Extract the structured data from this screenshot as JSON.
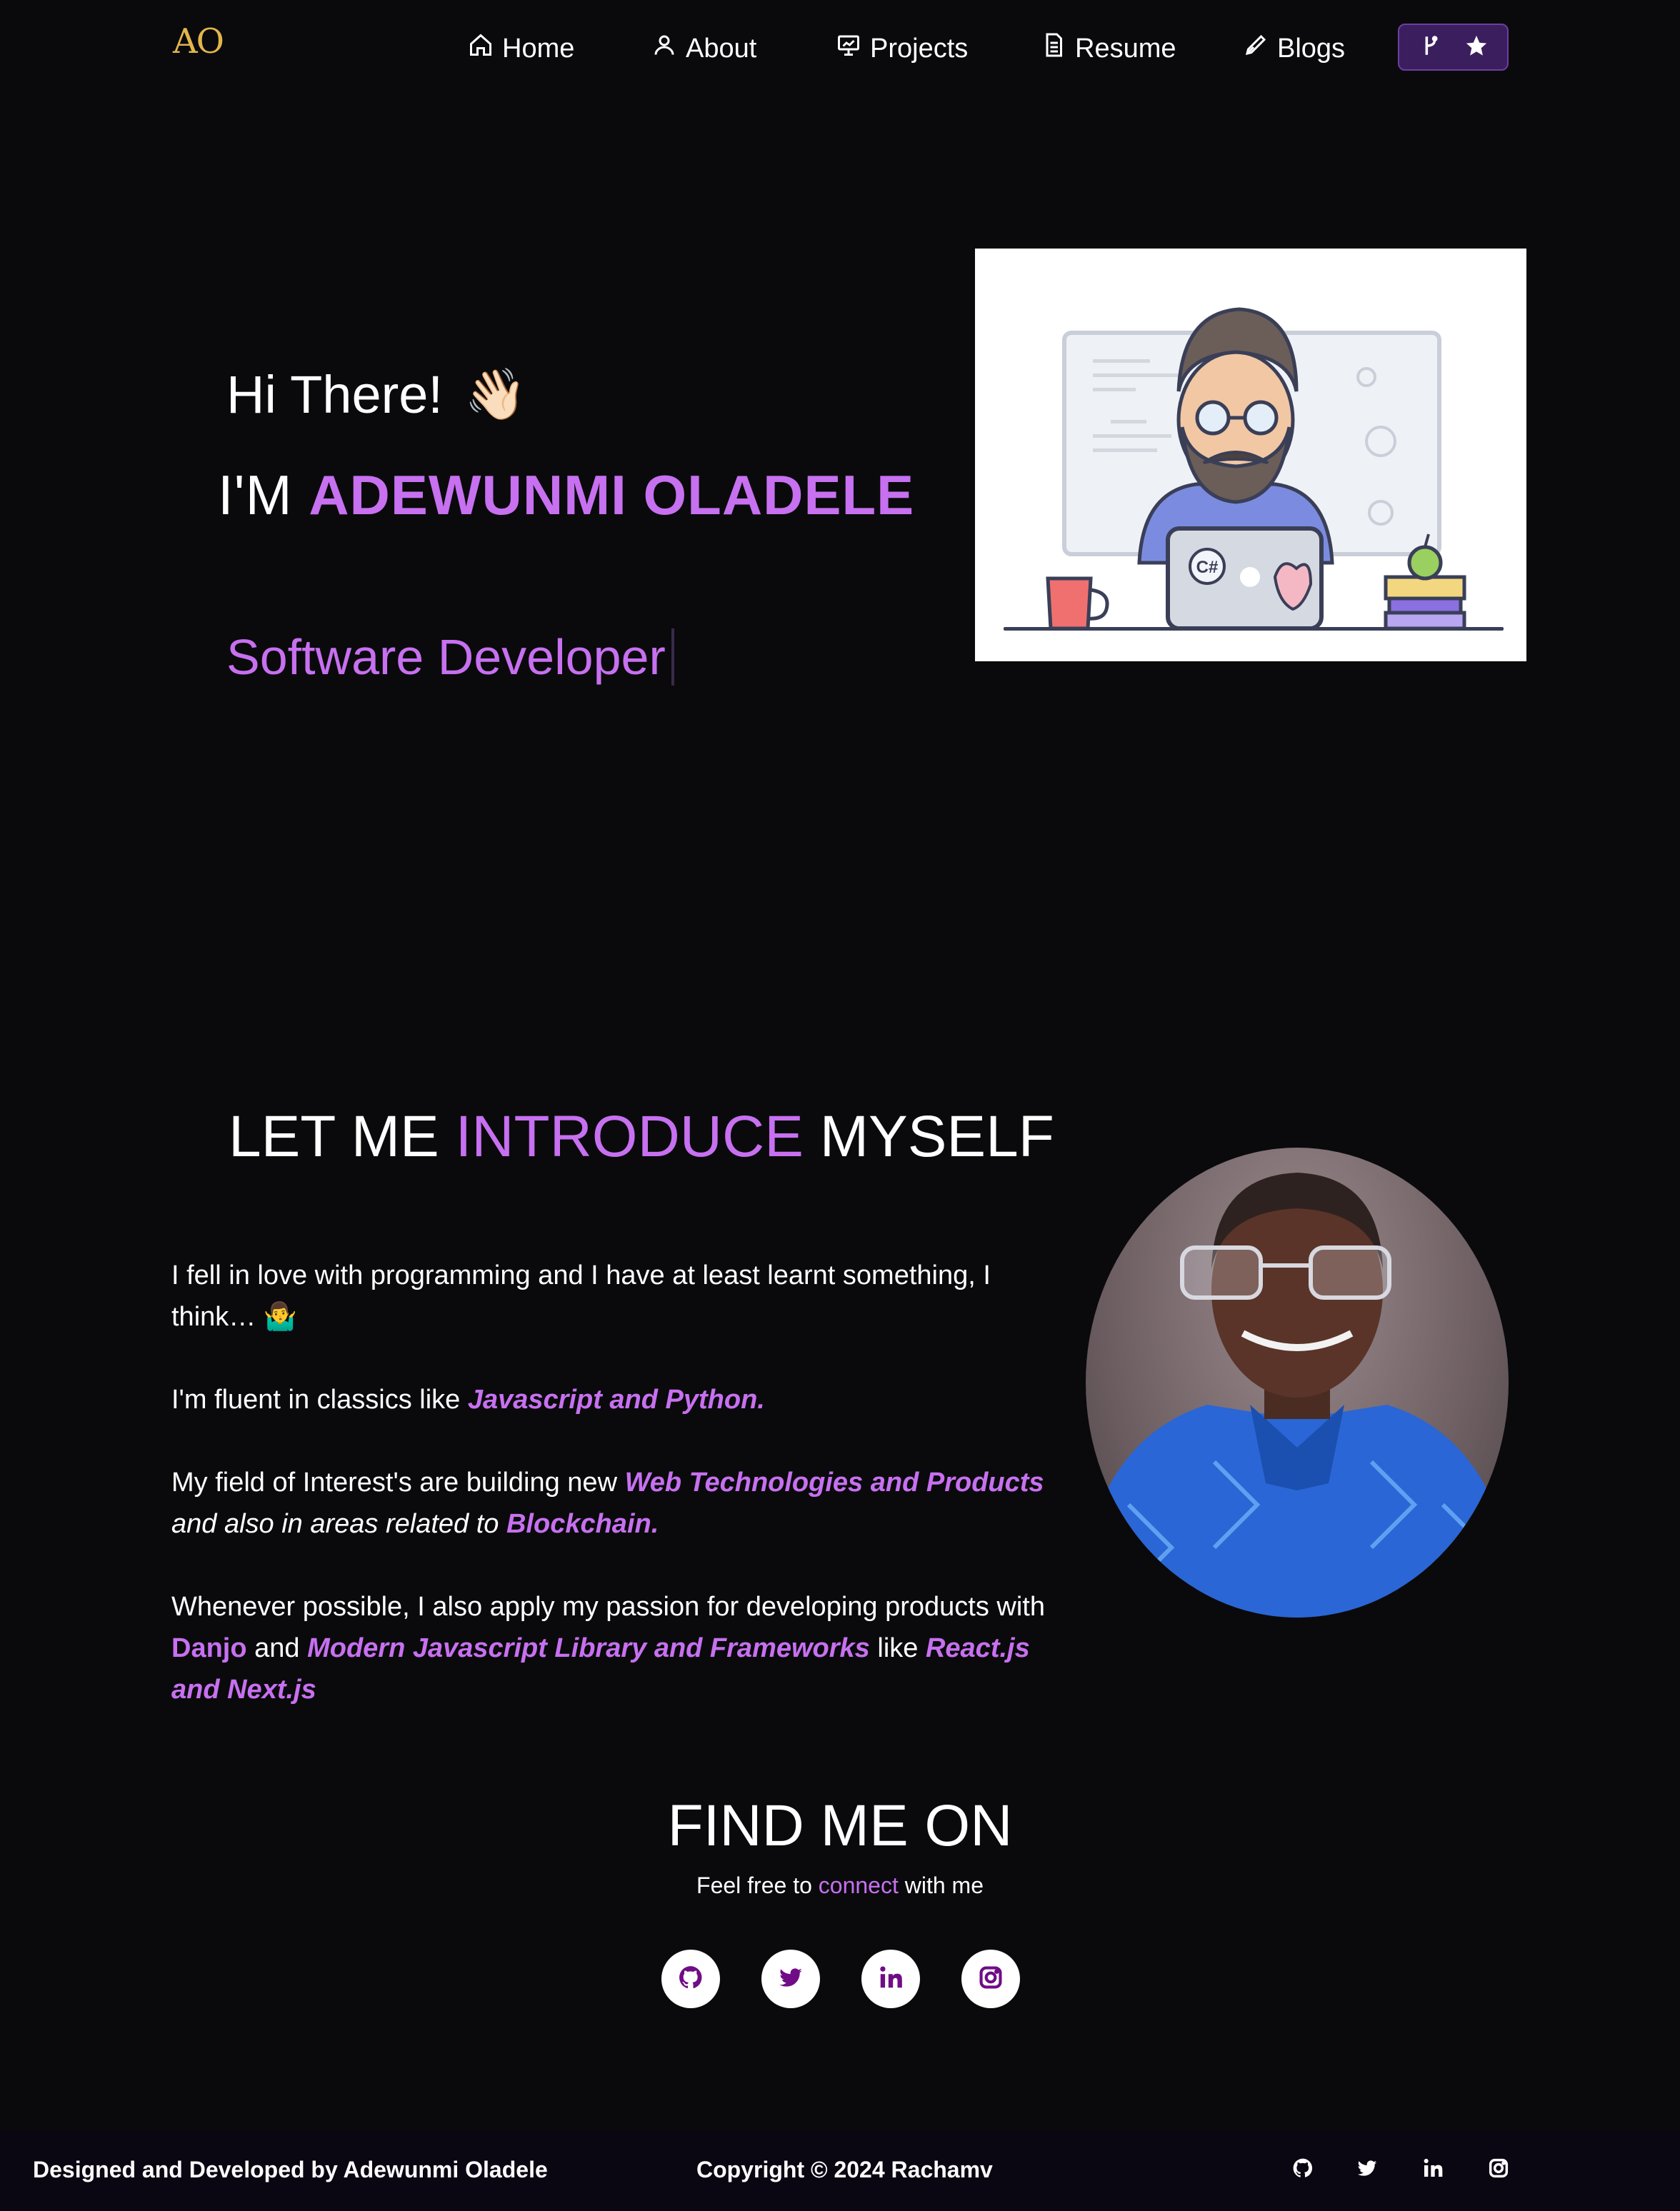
{
  "nav": {
    "logo": "AO",
    "items": [
      {
        "label": "Home",
        "icon": "home-icon"
      },
      {
        "label": "About",
        "icon": "user-icon"
      },
      {
        "label": "Projects",
        "icon": "projects-icon"
      },
      {
        "label": "Resume",
        "icon": "document-icon"
      },
      {
        "label": "Blogs",
        "icon": "pen-icon"
      }
    ],
    "star_button_icons": [
      "git-fork-icon",
      "star-icon"
    ]
  },
  "hero": {
    "greeting": "Hi There!",
    "wave": "👋🏻",
    "im_prefix": "I'M ",
    "name": "ADEWUNMI OLADELE",
    "role": "Software Developer"
  },
  "intro": {
    "title_a": "LET ME ",
    "title_b": "INTRODUCE",
    "title_c": " MYSELF",
    "p1": "I fell in love with programming and I have at least learnt something, I think… 🤷‍♂️",
    "p2_a": "I'm fluent in classics like ",
    "p2_b": "Javascript and Python.",
    "p3_a": "My field of Interest's are building new  ",
    "p3_b": "Web Technologies and Products",
    "p3_c": "and also in areas related to ",
    "p3_d": "Blockchain.",
    "p4_a": "Whenever possible, I also apply my passion for developing products with ",
    "p4_b": "Danjo",
    "p4_c": " and ",
    "p4_d": "Modern Javascript Library and Frameworks",
    "p4_e": "  like ",
    "p4_f": "React.js and Next.js"
  },
  "find": {
    "title": "FIND ME ON",
    "sub_a": "Feel free to ",
    "sub_b": "connect",
    "sub_c": " with me",
    "socials": [
      "github-icon",
      "twitter-icon",
      "linkedin-icon",
      "instagram-icon"
    ]
  },
  "footer": {
    "designed": "Designed and Developed by Adewunmi Oladele",
    "copyright": "Copyright © 2024 Rachamv"
  },
  "colors": {
    "accent": "#c770f0",
    "background": "#0a0a0c",
    "logo": "#e2b54c",
    "social_icon": "#700c86"
  }
}
